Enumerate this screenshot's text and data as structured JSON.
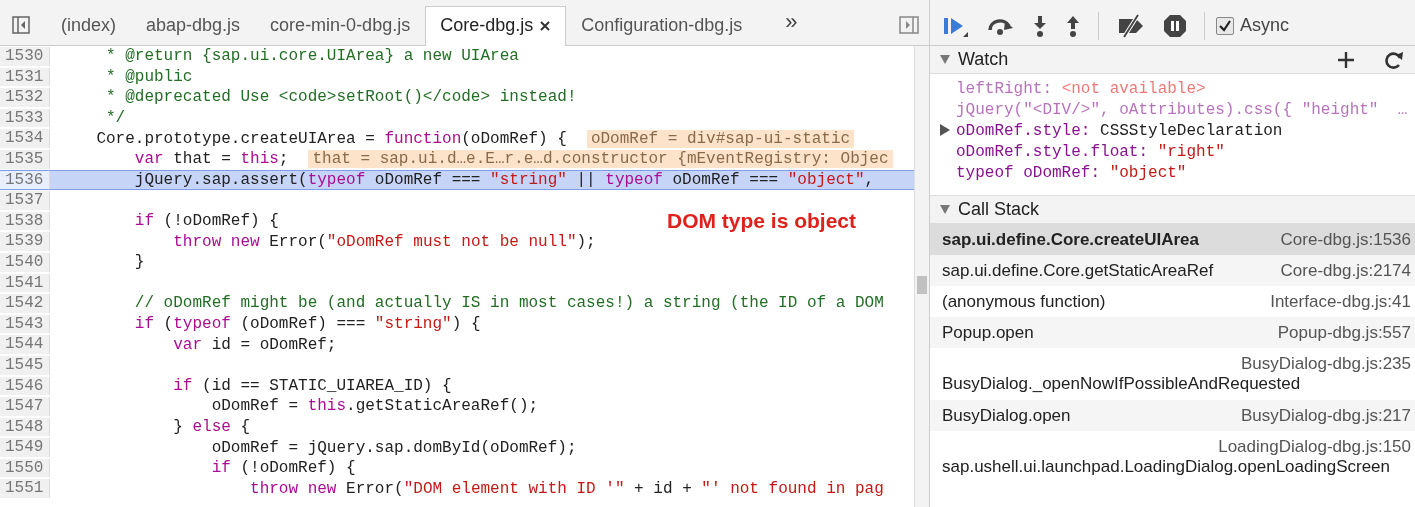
{
  "tabs": [
    {
      "label": "(index)",
      "selected": false,
      "closable": false
    },
    {
      "label": "abap-dbg.js",
      "selected": false,
      "closable": false
    },
    {
      "label": "core-min-0-dbg.js",
      "selected": false,
      "closable": false
    },
    {
      "label": "Core-dbg.js",
      "selected": true,
      "closable": true
    },
    {
      "label": "Configuration-dbg.js",
      "selected": false,
      "closable": false
    }
  ],
  "more_tabs": "»",
  "code": [
    {
      "number": "1530",
      "highlighted": false,
      "tokens": [
        {
          "kind": "comment",
          "text": "     * @return {sap.ui.core.UIArea} a new UIArea"
        }
      ]
    },
    {
      "number": "1531",
      "highlighted": false,
      "tokens": [
        {
          "kind": "comment",
          "text": "     * @public"
        }
      ]
    },
    {
      "number": "1532",
      "highlighted": false,
      "tokens": [
        {
          "kind": "comment",
          "text": "     * @deprecated Use <code>setRoot()</code> instead!"
        }
      ]
    },
    {
      "number": "1533",
      "highlighted": false,
      "tokens": [
        {
          "kind": "comment",
          "text": "     */"
        }
      ]
    },
    {
      "number": "1534",
      "highlighted": false,
      "tokens": [
        {
          "kind": "plain",
          "text": "    Core.prototype.createUIArea = "
        },
        {
          "kind": "keyword",
          "text": "function"
        },
        {
          "kind": "plain",
          "text": "(oDomRef) {"
        }
      ],
      "inline_value": "oDomRef = div#sap-ui-static"
    },
    {
      "number": "1535",
      "highlighted": false,
      "tokens": [
        {
          "kind": "keyword",
          "text": "        var"
        },
        {
          "kind": "plain",
          "text": " that = "
        },
        {
          "kind": "keyword",
          "text": "this"
        },
        {
          "kind": "plain",
          "text": ";"
        }
      ],
      "inline_value": "that = sap.ui.d…e.E…r.e…d.constructor {mEventRegistry: Objec"
    },
    {
      "number": "1536",
      "highlighted": true,
      "tokens": [
        {
          "kind": "plain",
          "text": "        jQuery.sap.assert("
        },
        {
          "kind": "keyword",
          "text": "typeof"
        },
        {
          "kind": "plain",
          "text": " oDomRef === "
        },
        {
          "kind": "string",
          "text": "\"string\""
        },
        {
          "kind": "plain",
          "text": " || "
        },
        {
          "kind": "keyword",
          "text": "typeof"
        },
        {
          "kind": "plain",
          "text": " oDomRef === "
        },
        {
          "kind": "string",
          "text": "\"object\""
        },
        {
          "kind": "plain",
          "text": ","
        }
      ]
    },
    {
      "number": "1537",
      "highlighted": false
    },
    {
      "number": "1538",
      "highlighted": false,
      "tokens": [
        {
          "kind": "keyword",
          "text": "        if"
        },
        {
          "kind": "plain",
          "text": " (!oDomRef) {"
        }
      ]
    },
    {
      "number": "1539",
      "highlighted": false,
      "tokens": [
        {
          "kind": "keyword",
          "text": "            throw new"
        },
        {
          "kind": "plain",
          "text": " Error("
        },
        {
          "kind": "string",
          "text": "\"oDomRef must not be null\""
        },
        {
          "kind": "plain",
          "text": ");"
        }
      ]
    },
    {
      "number": "1540",
      "highlighted": false,
      "tokens": [
        {
          "kind": "plain",
          "text": "        }"
        }
      ]
    },
    {
      "number": "1541",
      "highlighted": false
    },
    {
      "number": "1542",
      "highlighted": false,
      "tokens": [
        {
          "kind": "comment",
          "text": "        // oDomRef might be (and actually IS in most cases!) a string (the ID of a DOM"
        }
      ]
    },
    {
      "number": "1543",
      "highlighted": false,
      "tokens": [
        {
          "kind": "keyword",
          "text": "        if"
        },
        {
          "kind": "plain",
          "text": " ("
        },
        {
          "kind": "keyword",
          "text": "typeof"
        },
        {
          "kind": "plain",
          "text": " (oDomRef) === "
        },
        {
          "kind": "string",
          "text": "\"string\""
        },
        {
          "kind": "plain",
          "text": ") {"
        }
      ]
    },
    {
      "number": "1544",
      "highlighted": false,
      "tokens": [
        {
          "kind": "keyword",
          "text": "            var"
        },
        {
          "kind": "plain",
          "text": " id = oDomRef;"
        }
      ]
    },
    {
      "number": "1545",
      "highlighted": false
    },
    {
      "number": "1546",
      "highlighted": false,
      "tokens": [
        {
          "kind": "keyword",
          "text": "            if"
        },
        {
          "kind": "plain",
          "text": " (id == STATIC_UIAREA_ID) {"
        }
      ]
    },
    {
      "number": "1547",
      "highlighted": false,
      "tokens": [
        {
          "kind": "plain",
          "text": "                oDomRef = "
        },
        {
          "kind": "keyword",
          "text": "this"
        },
        {
          "kind": "plain",
          "text": ".getStaticAreaRef();"
        }
      ]
    },
    {
      "number": "1548",
      "highlighted": false,
      "tokens": [
        {
          "kind": "plain",
          "text": "            } "
        },
        {
          "kind": "keyword",
          "text": "else"
        },
        {
          "kind": "plain",
          "text": " {"
        }
      ]
    },
    {
      "number": "1549",
      "highlighted": false,
      "tokens": [
        {
          "kind": "plain",
          "text": "                oDomRef = jQuery.sap.domById(oDomRef);"
        }
      ]
    },
    {
      "number": "1550",
      "highlighted": false,
      "tokens": [
        {
          "kind": "keyword",
          "text": "                if"
        },
        {
          "kind": "plain",
          "text": " (!oDomRef) {"
        }
      ]
    },
    {
      "number": "1551",
      "highlighted": false,
      "tokens": [
        {
          "kind": "keyword",
          "text": "                    throw new"
        },
        {
          "kind": "plain",
          "text": " Error("
        },
        {
          "kind": "string",
          "text": "\"DOM element with ID '\""
        },
        {
          "kind": "plain",
          "text": " + id + "
        },
        {
          "kind": "string",
          "text": "\"' not found in pag"
        }
      ]
    }
  ],
  "annotation": "DOM type is object",
  "async": {
    "label": "Async",
    "checked": true
  },
  "watch": {
    "title": "Watch",
    "expanded": true,
    "items": [
      {
        "name": "leftRight:",
        "value": "<not available>",
        "unavailable": true,
        "expandable": false
      },
      {
        "name": "jQuery(\"<DIV/>\", oAttributes).css({ \"height\"  …",
        "unavailable": true,
        "expandable": false
      },
      {
        "name": "oDomRef.style:",
        "value": "CSSStyleDeclaration",
        "unavailable": false,
        "expandable": true
      },
      {
        "name": "oDomRef.style.float:",
        "value": "\"right\"",
        "unavailable": false,
        "expandable": false
      },
      {
        "name": "typeof oDomRef:",
        "value": "\"object\"",
        "unavailable": false,
        "expandable": false
      }
    ]
  },
  "call_stack": {
    "title": "Call Stack",
    "expanded": true,
    "frames": [
      {
        "function": "sap.ui.define.Core.createUIArea",
        "location": "Core-dbg.js:1536",
        "selected": true,
        "wrapped": false
      },
      {
        "function": "sap.ui.define.Core.getStaticAreaRef",
        "location": "Core-dbg.js:2174",
        "selected": false,
        "wrapped": false
      },
      {
        "function": "(anonymous function)",
        "location": "Interface-dbg.js:41",
        "selected": false,
        "wrapped": false
      },
      {
        "function": "Popup.open",
        "location": "Popup-dbg.js:557",
        "selected": false,
        "wrapped": false
      },
      {
        "function": "BusyDialog._openNowIfPossibleAndRequested",
        "location": "BusyDialog-dbg.js:235",
        "selected": false,
        "wrapped": true
      },
      {
        "function": "BusyDialog.open",
        "location": "BusyDialog-dbg.js:217",
        "selected": false,
        "wrapped": false
      },
      {
        "function": "sap.ushell.ui.launchpad.LoadingDialog.openLoadingScreen",
        "location": "LoadingDialog-dbg.js:150",
        "selected": false,
        "wrapped": true
      }
    ]
  }
}
